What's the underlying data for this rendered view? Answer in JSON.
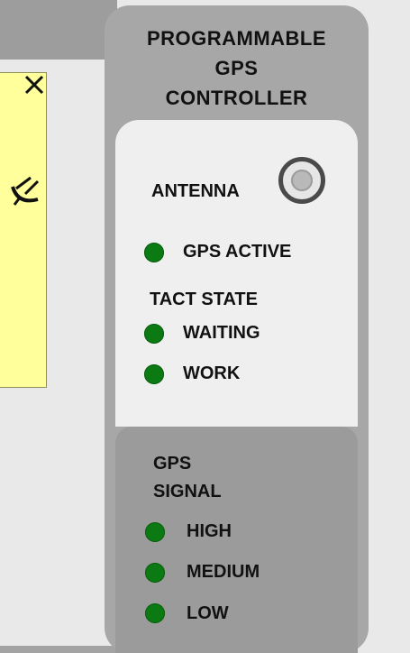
{
  "controller": {
    "title_line1": "PROGRAMMABLE",
    "title_line2": "GPS",
    "title_line3": "CONTROLLER",
    "antenna_label": "ANTENNA",
    "gps_active_label": "GPS ACTIVE",
    "tact_state_label": "TACT STATE",
    "waiting_label": "WAITING",
    "work_label": "WORK",
    "signal_title_line1": "GPS",
    "signal_title_line2": "SIGNAL",
    "high_label": "HIGH",
    "medium_label": "MEDIUM",
    "low_label": "LOW",
    "led_color": "#0b7a12"
  },
  "side_panel": {
    "close_icon": "close-icon",
    "dish_icon": "satellite-dish-icon",
    "color": "#ffff9c"
  }
}
